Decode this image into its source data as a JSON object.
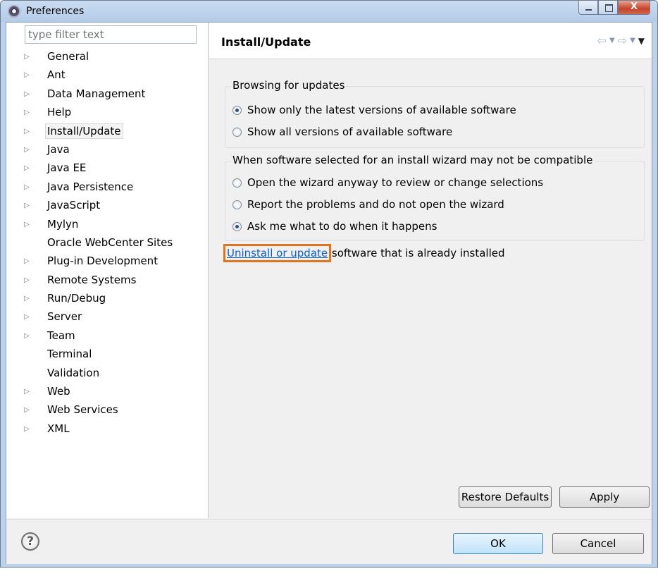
{
  "window": {
    "title": "Preferences",
    "close_glyph": "X"
  },
  "left": {
    "filter_placeholder": "type filter text",
    "tree": [
      {
        "label": "General",
        "expandable": true
      },
      {
        "label": "Ant",
        "expandable": true
      },
      {
        "label": "Data Management",
        "expandable": true
      },
      {
        "label": "Help",
        "expandable": true
      },
      {
        "label": "Install/Update",
        "expandable": true,
        "selected": true
      },
      {
        "label": "Java",
        "expandable": true
      },
      {
        "label": "Java EE",
        "expandable": true
      },
      {
        "label": "Java Persistence",
        "expandable": true
      },
      {
        "label": "JavaScript",
        "expandable": true
      },
      {
        "label": "Mylyn",
        "expandable": true
      },
      {
        "label": "Oracle WebCenter Sites",
        "expandable": false
      },
      {
        "label": "Plug-in Development",
        "expandable": true
      },
      {
        "label": "Remote Systems",
        "expandable": true
      },
      {
        "label": "Run/Debug",
        "expandable": true
      },
      {
        "label": "Server",
        "expandable": true
      },
      {
        "label": "Team",
        "expandable": true
      },
      {
        "label": "Terminal",
        "expandable": false
      },
      {
        "label": "Validation",
        "expandable": false
      },
      {
        "label": "Web",
        "expandable": true
      },
      {
        "label": "Web Services",
        "expandable": true
      },
      {
        "label": "XML",
        "expandable": true
      }
    ]
  },
  "page": {
    "title": "Install/Update",
    "browsing": {
      "legend": "Browsing for updates",
      "opt_latest": "Show only the latest versions of available software",
      "opt_all": "Show all versions of available software",
      "selected": "latest"
    },
    "compat": {
      "legend": "When software selected for an install wizard may not be compatible",
      "opt_open": "Open the wizard anyway to review or change selections",
      "opt_report": "Report the problems and do not open the wizard",
      "opt_ask": "Ask me what to do when it happens",
      "selected": "ask"
    },
    "link_text": "Uninstall or update",
    "link_suffix": " software that is already installed",
    "restore_defaults": "Restore Defaults",
    "apply": "Apply"
  },
  "footer": {
    "help_glyph": "?",
    "ok": "OK",
    "cancel": "Cancel"
  },
  "colors": {
    "link": "#0b5fd6",
    "highlight_outline": "#e2741d"
  },
  "icons": {
    "app": "eclipse-icon",
    "back": "back-arrow-icon",
    "forward": "forward-arrow-icon",
    "menu": "view-menu-icon",
    "help": "help-icon"
  }
}
